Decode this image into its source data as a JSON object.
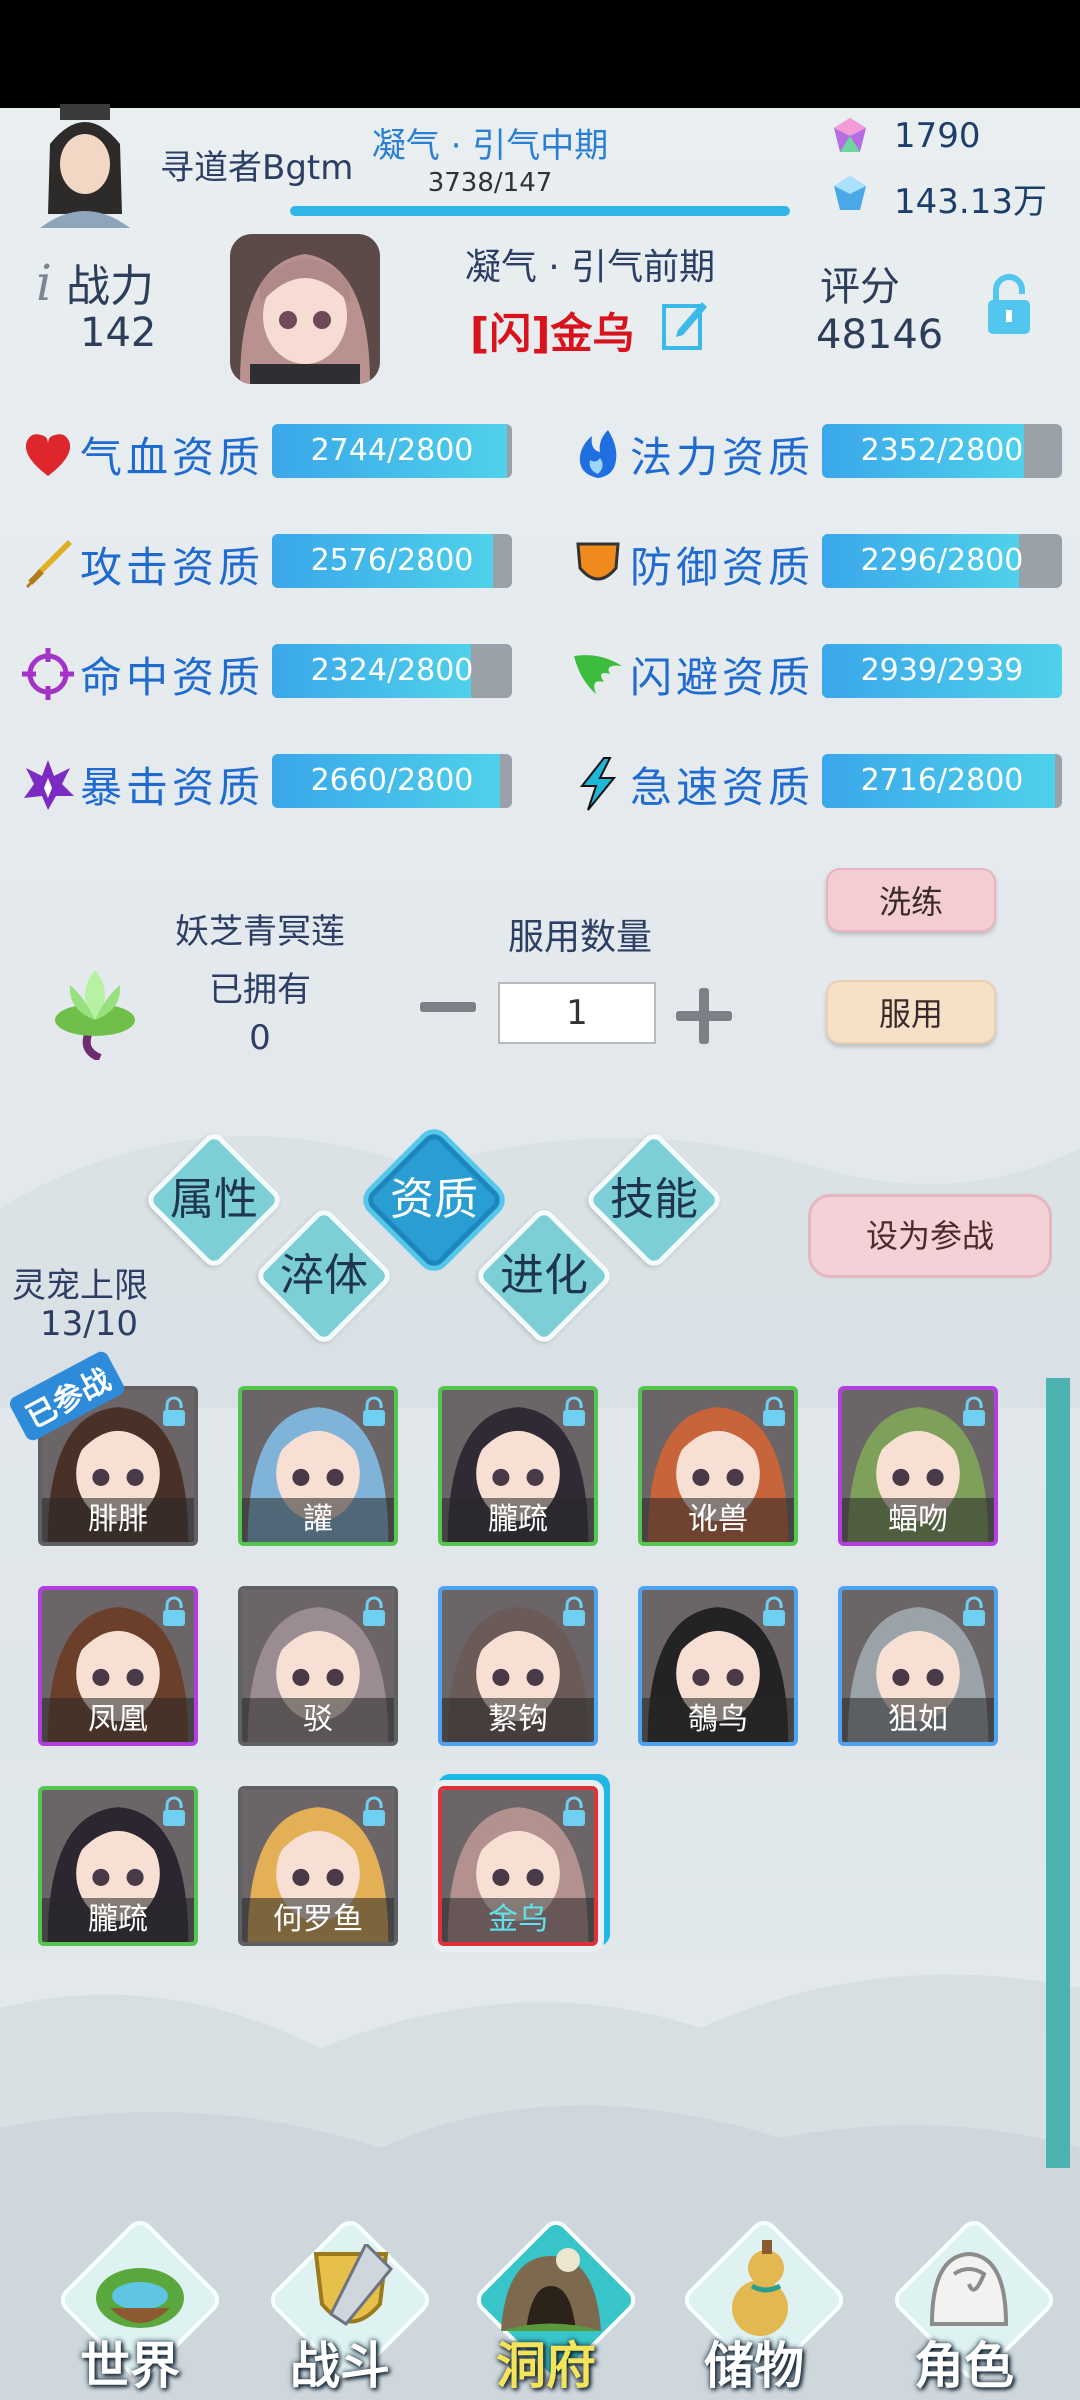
{
  "header": {
    "player_name": "寻道者Bgtm",
    "realm": "凝气 · 引气中期",
    "exp": "3738/147",
    "gem_purple": "1790",
    "gem_blue": "143.13万"
  },
  "pet": {
    "power_label": "战力",
    "power_value": "142",
    "realm": "凝气 · 引气前期",
    "name": "[闪]金乌",
    "score_label": "评分",
    "score_value": "48146"
  },
  "attributes": [
    {
      "label": "气血资质",
      "value": "2744/2800",
      "fraction": 0.98,
      "icon": "heart-icon",
      "color": "#e0262d"
    },
    {
      "label": "法力资质",
      "value": "2352/2800",
      "fraction": 0.84,
      "icon": "flame-icon",
      "color": "#1f6fe0"
    },
    {
      "label": "攻击资质",
      "value": "2576/2800",
      "fraction": 0.92,
      "icon": "sword-icon",
      "color": "#e0b020"
    },
    {
      "label": "防御资质",
      "value": "2296/2800",
      "fraction": 0.82,
      "icon": "shield-icon",
      "color": "#f08a1c"
    },
    {
      "label": "命中资质",
      "value": "2324/2800",
      "fraction": 0.83,
      "icon": "crosshair-icon",
      "color": "#a433c8"
    },
    {
      "label": "闪避资质",
      "value": "2939/2939",
      "fraction": 1.0,
      "icon": "wing-icon",
      "color": "#3dbd3d"
    },
    {
      "label": "暴击资质",
      "value": "2660/2800",
      "fraction": 0.95,
      "icon": "burst-icon",
      "color": "#7b2bc2"
    },
    {
      "label": "急速资质",
      "value": "2716/2800",
      "fraction": 0.97,
      "icon": "lightning-icon",
      "color": "#1fb7d8"
    }
  ],
  "herb": {
    "name": "妖芝青冥莲",
    "owned_label": "已拥有",
    "owned_value": "0",
    "qty_label": "服用数量",
    "qty_value": "1",
    "wash_button": "洗练",
    "use_button": "服用"
  },
  "tabs": [
    {
      "label": "属性",
      "selected": false
    },
    {
      "label": "资质",
      "selected": true
    },
    {
      "label": "技能",
      "selected": false
    },
    {
      "label": "淬体",
      "selected": false
    },
    {
      "label": "进化",
      "selected": false
    }
  ],
  "set_battle_button": "设为参战",
  "capacity": {
    "label": "灵宠上限",
    "value": "13/10"
  },
  "joined_tag": "已参战",
  "pets": [
    {
      "name": "腓腓",
      "border": "gray",
      "hair": "#4a3128"
    },
    {
      "name": "讙",
      "border": "green",
      "hair": "#7fb3d8"
    },
    {
      "name": "朧疏",
      "border": "green",
      "hair": "#2f2a33"
    },
    {
      "name": "讹兽",
      "border": "green",
      "hair": "#c7643a"
    },
    {
      "name": "蝠吻",
      "border": "purple",
      "hair": "#7ea05a"
    },
    {
      "name": "凤凰",
      "border": "purple",
      "hair": "#6b3f2a"
    },
    {
      "name": "驳",
      "border": "gray",
      "hair": "#9b8c92"
    },
    {
      "name": "絜钩",
      "border": "blue",
      "hair": "#6a5a58"
    },
    {
      "name": "鵸鸟",
      "border": "blue",
      "hair": "#232325"
    },
    {
      "name": "狙如",
      "border": "blue",
      "hair": "#9aa3a8"
    },
    {
      "name": "朧疏",
      "border": "green",
      "hair": "#2b2630"
    },
    {
      "name": "何罗鱼",
      "border": "gray",
      "hair": "#e3b055"
    },
    {
      "name": "金乌",
      "border": "red",
      "hair": "#b3918e"
    }
  ],
  "nav": [
    {
      "label": "世界",
      "selected": false
    },
    {
      "label": "战斗",
      "selected": false
    },
    {
      "label": "洞府",
      "selected": true
    },
    {
      "label": "储物",
      "selected": false
    },
    {
      "label": "角色",
      "selected": false
    }
  ]
}
